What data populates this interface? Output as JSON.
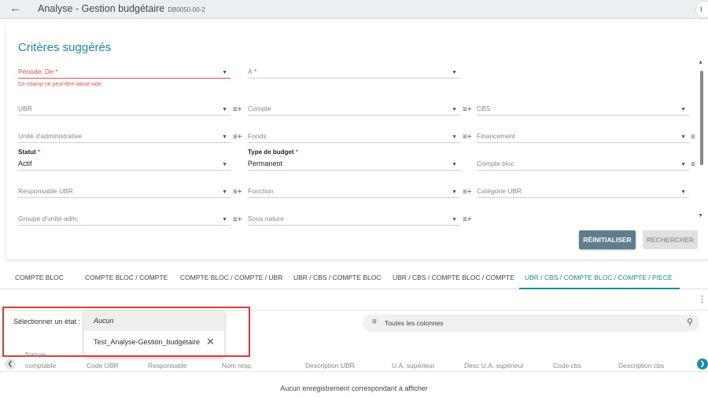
{
  "header": {
    "title": "Analyse - Gestion budgétaire",
    "code": "DB0050-00-2",
    "avatar_initial": "I"
  },
  "criteria": {
    "title": "Critères suggérés",
    "periode_label": "Période: De",
    "periode_error": "Ce champ ne peut être laissé vide.",
    "a_label": "À",
    "required_mark": "*",
    "fields": {
      "ubr": "UBR",
      "compte": "Compte",
      "cbs": "CBS",
      "unite_admin": "Unité d'administrative",
      "fonds": "Fonds",
      "financement": "Financement",
      "statut_label": "Statut",
      "statut_value": "Actif",
      "type_budget_label": "Type de budget",
      "type_budget_value": "Permanent",
      "compte_bloc": "Compte bloc",
      "responsable_ubr": "Responsable UBR",
      "fonction": "Fonction",
      "categorie_ubr": "Catégorie UBR",
      "groupe_unite": "Groupe d'unité adm.",
      "sous_nature": "Sous nature"
    },
    "reset_label": "RÉINITIALISER",
    "search_label": "RECHERCHER"
  },
  "tabs": [
    {
      "label": "COMPTE BLOC"
    },
    {
      "label": "COMPTE BLOC / COMPTE"
    },
    {
      "label": "COMPTE BLOC / COMPTE / UBR"
    },
    {
      "label": "UBR / CBS / COMPTE BLOC"
    },
    {
      "label": "UBR / CBS / COMPTE BLOC / COMPTE"
    },
    {
      "label": "UBR / CBS / COMPTE BLOC / COMPTE / PIECE"
    }
  ],
  "state_selector": {
    "label": "Sélectionner un état :",
    "options": [
      "Aucun",
      "Test_Analyse-Gestion_budgétaire"
    ]
  },
  "column_search": {
    "label": "Toutes les colonnes"
  },
  "grid": {
    "columns": [
      "Nature",
      "comptable",
      "Code UBR",
      "Responsable",
      "Nom resp.",
      "Description UBR",
      "U.A. supérieur",
      "Desc U.A. supérieur",
      "Code cbs",
      "Description cbs"
    ],
    "empty_message": "Aucun enregistrement correspondant à afficher"
  },
  "colors": {
    "accent": "#1a8ca8",
    "error": "#e05050",
    "highlight_box": "#e53935"
  }
}
